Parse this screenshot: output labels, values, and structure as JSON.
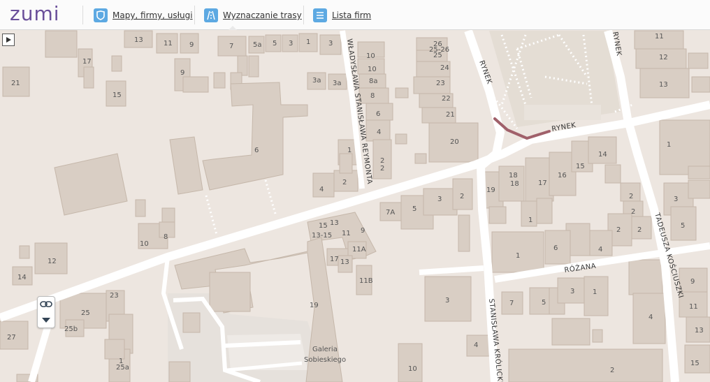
{
  "header": {
    "logo_text": "zumi",
    "nav": [
      {
        "label": "Mapy, firmy, usługi",
        "icon": "map-shield-icon"
      },
      {
        "label": "Wyznaczanie trasy",
        "icon": "route-icon"
      },
      {
        "label": "Lista firm",
        "icon": "list-icon"
      }
    ]
  },
  "colors": {
    "accent": "#5da9e2",
    "logo": "#6a4f9a",
    "map_background": "#ede6e0",
    "building": "#d9cec4",
    "road": "#ffffff",
    "route_highlight": "#a0606a"
  },
  "map": {
    "streets": [
      "RYNEK",
      "RYNEK",
      "RYNEK",
      "WŁADYSŁAWA STANISŁAWA REYMONTA",
      "TADEUSZA KOŚCIUSZKI",
      "RÓŻANA",
      "STANISŁAWA KRÓLICKIEGO"
    ],
    "poi": [
      "Galeria",
      "Sobieskiego"
    ],
    "building_numbers": [
      "13",
      "11",
      "9",
      "7",
      "5a",
      "5",
      "3",
      "1",
      "3",
      "17",
      "9",
      "21",
      "15",
      "3a",
      "3a",
      "10",
      "10",
      "8a",
      "8",
      "6",
      "4",
      "1",
      "2",
      "2",
      "26",
      "25-26",
      "25",
      "24",
      "23",
      "22",
      "21",
      "20",
      "6",
      "4",
      "2",
      "10",
      "8",
      "12",
      "14",
      "15",
      "13",
      "13-15",
      "11",
      "9",
      "11A",
      "17",
      "13",
      "11B",
      "19",
      "7A",
      "5",
      "3",
      "2",
      "19",
      "18",
      "18",
      "17",
      "16",
      "15",
      "14",
      "1",
      "6",
      "1",
      "4",
      "2",
      "2",
      "2",
      "2",
      "3",
      "5",
      "1",
      "9",
      "11",
      "13",
      "15",
      "7",
      "5",
      "3",
      "1",
      "4",
      "4",
      "2",
      "3",
      "10",
      "23",
      "25",
      "25b",
      "27",
      "1",
      "25a",
      "11",
      "12",
      "13"
    ]
  },
  "controls": {
    "panel_toggle_icon": "play-triangle-icon",
    "link_icon": "link-icon",
    "expand_icon": "chevron-down-icon"
  }
}
